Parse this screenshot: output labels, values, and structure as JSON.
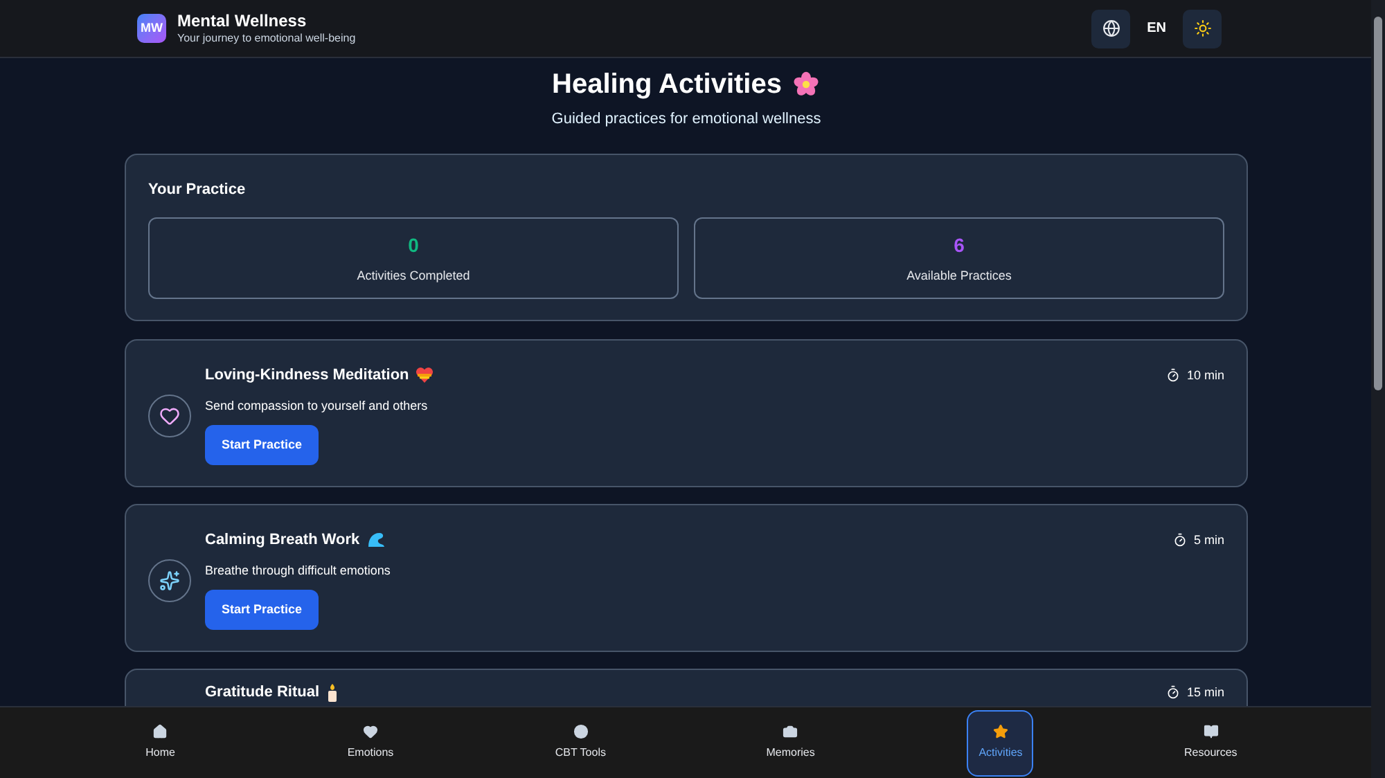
{
  "header": {
    "logo": "MW",
    "title": "Mental Wellness",
    "subtitle": "Your journey to emotional well-being",
    "language": "EN"
  },
  "page": {
    "title": "Healing Activities",
    "subtitle": "Guided practices for emotional wellness"
  },
  "practice": {
    "title": "Your Practice",
    "stats": [
      {
        "value": "0",
        "label": "Activities Completed",
        "color": "#10b981"
      },
      {
        "value": "6",
        "label": "Available Practices",
        "color": "#a855f7"
      }
    ]
  },
  "activities": [
    {
      "title": "Loving-Kindness Meditation",
      "description": "Send compassion to yourself and others",
      "duration": "10 min",
      "button": "Start Practice"
    },
    {
      "title": "Calming Breath Work",
      "description": "Breathe through difficult emotions",
      "duration": "5 min",
      "button": "Start Practice"
    },
    {
      "title": "Gratitude Ritual",
      "duration": "15 min"
    }
  ],
  "nav": [
    {
      "label": "Home",
      "selected": false
    },
    {
      "label": "Emotions",
      "selected": false
    },
    {
      "label": "CBT Tools",
      "selected": false
    },
    {
      "label": "Memories",
      "selected": false
    },
    {
      "label": "Activities",
      "selected": true
    },
    {
      "label": "Resources",
      "selected": false
    }
  ]
}
